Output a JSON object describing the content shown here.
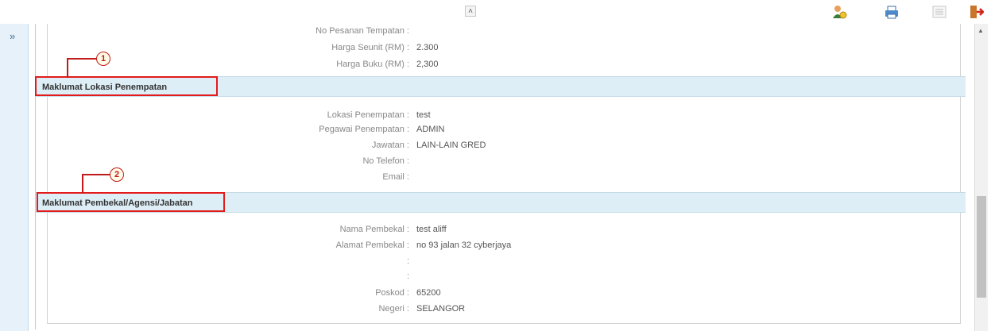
{
  "toolbar": {
    "collapse_icon": "double-chevron-up-icon",
    "icons": [
      "user-settings-icon",
      "print-icon",
      "list-view-icon",
      "exit-icon"
    ]
  },
  "side": {
    "expand_glyph": "»"
  },
  "rows_top": [
    {
      "label": "No Pesanan Tempatan :",
      "value": ""
    },
    {
      "label": "Harga Seunit (RM) :",
      "value": "2.300"
    },
    {
      "label": "Harga Buku (RM) :",
      "value": "2,300"
    }
  ],
  "section1": {
    "title": "Maklumat Lokasi Penempatan",
    "callout": "1"
  },
  "rows_lokasi": [
    {
      "label": "Lokasi Penempatan :",
      "value": "test"
    },
    {
      "label": "Pegawai Penempatan :",
      "value": "ADMIN"
    },
    {
      "label": "Jawatan :",
      "value": "LAIN-LAIN GRED"
    },
    {
      "label": "No Telefon :",
      "value": ""
    },
    {
      "label": "Email :",
      "value": ""
    }
  ],
  "section2": {
    "title": "Maklumat Pembekal/Agensi/Jabatan",
    "callout": "2"
  },
  "rows_pembekal": [
    {
      "label": "Nama Pembekal :",
      "value": "test aliff"
    },
    {
      "label": "Alamat Pembekal :",
      "value": "no 93 jalan 32 cyberjaya"
    },
    {
      "label": ":",
      "value": ""
    },
    {
      "label": ":",
      "value": ""
    },
    {
      "label": "Poskod :",
      "value": "65200"
    },
    {
      "label": "Negeri :",
      "value": "SELANGOR"
    }
  ],
  "colors": {
    "header_bg": "#ddeef6",
    "callout_red": "#e31b1b"
  }
}
